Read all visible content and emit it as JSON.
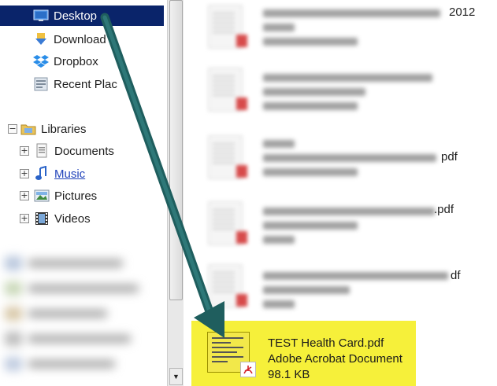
{
  "nav": {
    "favorites": [
      {
        "label": "Desktop",
        "icon": "desktop-icon",
        "selected": true
      },
      {
        "label": "Download",
        "icon": "downloads-icon"
      },
      {
        "label": "Dropbox",
        "icon": "dropbox-icon"
      },
      {
        "label": "Recent Plac",
        "icon": "recent-places-icon"
      }
    ],
    "libraries": {
      "label": "Libraries",
      "expander": "−",
      "items": [
        {
          "label": "Documents",
          "icon": "documents-icon",
          "expander": "+"
        },
        {
          "label": "Music",
          "icon": "music-icon",
          "expander": "+",
          "link": true
        },
        {
          "label": "Pictures",
          "icon": "pictures-icon",
          "expander": "+"
        },
        {
          "label": "Videos",
          "icon": "videos-icon",
          "expander": "+"
        }
      ]
    }
  },
  "files": {
    "blurred_suffixes": [
      "2012",
      "",
      "pdf",
      ".pdf",
      "df"
    ]
  },
  "selected_file": {
    "name": "TEST Health Card.pdf",
    "type": "Adobe Acrobat Document",
    "size": "98.1 KB"
  },
  "scrollbar": {
    "down_arrow": "▼"
  },
  "colors": {
    "selection": "#0a246a",
    "highlight": "#f6f03a",
    "arrow": "#1f5e5e"
  }
}
